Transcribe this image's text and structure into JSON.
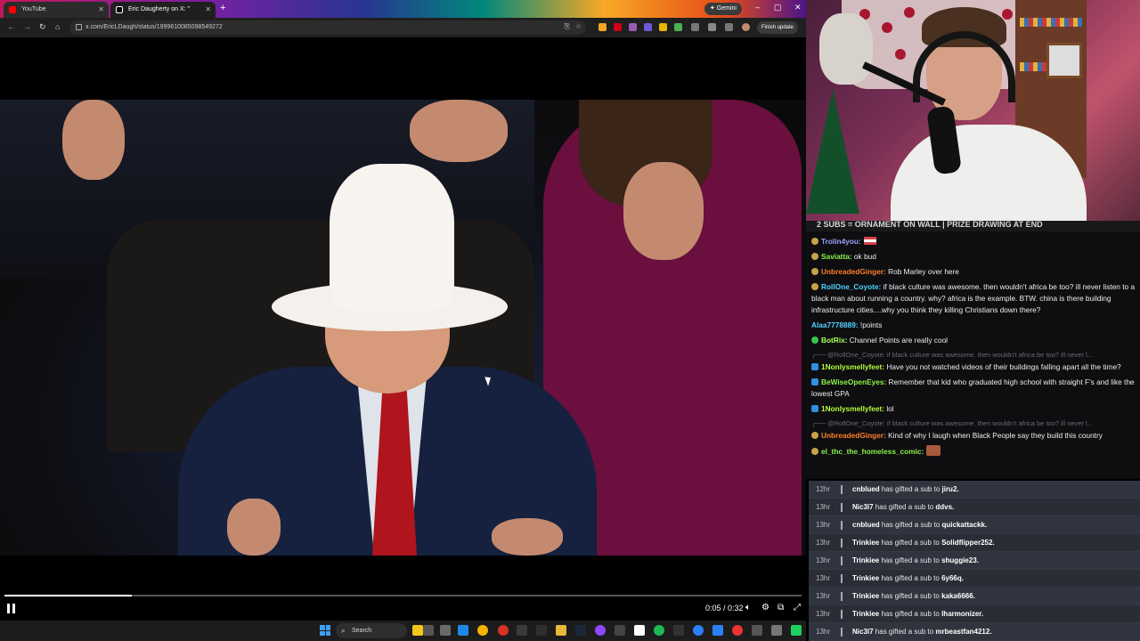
{
  "browser": {
    "tabs": [
      {
        "label": "YouTube",
        "color": "#ff0000",
        "active": false
      },
      {
        "label": "Eric Daugherty on X: \"",
        "color": "#ffffff",
        "active": true
      }
    ],
    "gemini_label": "✦ Gemini",
    "url": "x.com/EricLDaugh/status/1999610085098549272",
    "finish_update_label": "Finish update"
  },
  "video": {
    "progress_fraction": 0.16,
    "time_display": "0:05 / 0:32"
  },
  "taskbar": {
    "search_label": "Search"
  },
  "chat": {
    "banner": "2 SUBS = ORNAMENT ON WALL | PRIZE DRAWING AT END",
    "messages": [
      {
        "user": "Trolin4you:",
        "color": "#9aa0ff",
        "text": "",
        "flag": true,
        "badge": "gold"
      },
      {
        "user": "Saviatta:",
        "color": "#8cf24b",
        "text": "ok bud",
        "badge": "gold"
      },
      {
        "user": "UnbreadedGinger:",
        "color": "#ff7f2a",
        "text": "Rob Marley over here",
        "badge": "gold"
      },
      {
        "user": "RollOne_Coyote:",
        "color": "#4fd3ff",
        "text": "if black culture was awesome. then wouldn't africa be too? ill never listen to a black man about running a country. why? africa is the example. BTW. china is there building infrastructure cities....why you think they killing Christians down there?",
        "badge": "gold"
      },
      {
        "user": "Alaa7778889:",
        "color": "#4fd3ff",
        "text": "!points",
        "badge": "none"
      },
      {
        "user": "BotRix:",
        "color": "#a9ff5e",
        "text": "Channel Points are really cool",
        "badge": "green"
      },
      {
        "reply": "@RollOne_Coyote: if black culture was awesome. then wouldn't africa be too? ill never l..."
      },
      {
        "user": "1Nonlysmellyfeet:",
        "color": "#b7ff3a",
        "text": "Have you not watched videos of their buildings falling apart all the time?",
        "badge": "blue"
      },
      {
        "user": "BeWiseOpenEyes:",
        "color": "#8cf24b",
        "text": "Remember that kid who graduated high school with straight F's and like the lowest GPA",
        "badge": "blue"
      },
      {
        "user": "1Nonlysmellyfeet:",
        "color": "#b7ff3a",
        "text": "lol",
        "badge": "blue"
      },
      {
        "reply": "@RollOne_Coyote: if black culture was awesome. then wouldn't africa be too? ill never l..."
      },
      {
        "user": "UnbreadedGinger:",
        "color": "#ff7f2a",
        "text": "Kind of why I laugh when Black People say they build this country",
        "badge": "gold"
      },
      {
        "user": "el_thc_the_homeless_comic:",
        "color": "#8cf24b",
        "text": "",
        "emote": true,
        "badge": "gold"
      }
    ]
  },
  "events": [
    {
      "time": "12hr",
      "from": "cnblued",
      "to": "jiru2."
    },
    {
      "time": "13hr",
      "from": "Nic3l7",
      "to": "ddvs."
    },
    {
      "time": "13hr",
      "from": "cnblued",
      "to": "quickattackk."
    },
    {
      "time": "13hr",
      "from": "Trinkiee",
      "to": "Solidflipper252."
    },
    {
      "time": "13hr",
      "from": "Trinkiee",
      "to": "shuggie23."
    },
    {
      "time": "13hr",
      "from": "Trinkiee",
      "to": "6y66q."
    },
    {
      "time": "13hr",
      "from": "Trinkiee",
      "to": "kaka6666."
    },
    {
      "time": "13hr",
      "from": "Trinkiee",
      "to": "lharmonizer."
    },
    {
      "time": "13hr",
      "from": "Nic3l7",
      "to": "mrbeastfan4212."
    }
  ],
  "event_middle_text": " has gifted a sub to "
}
